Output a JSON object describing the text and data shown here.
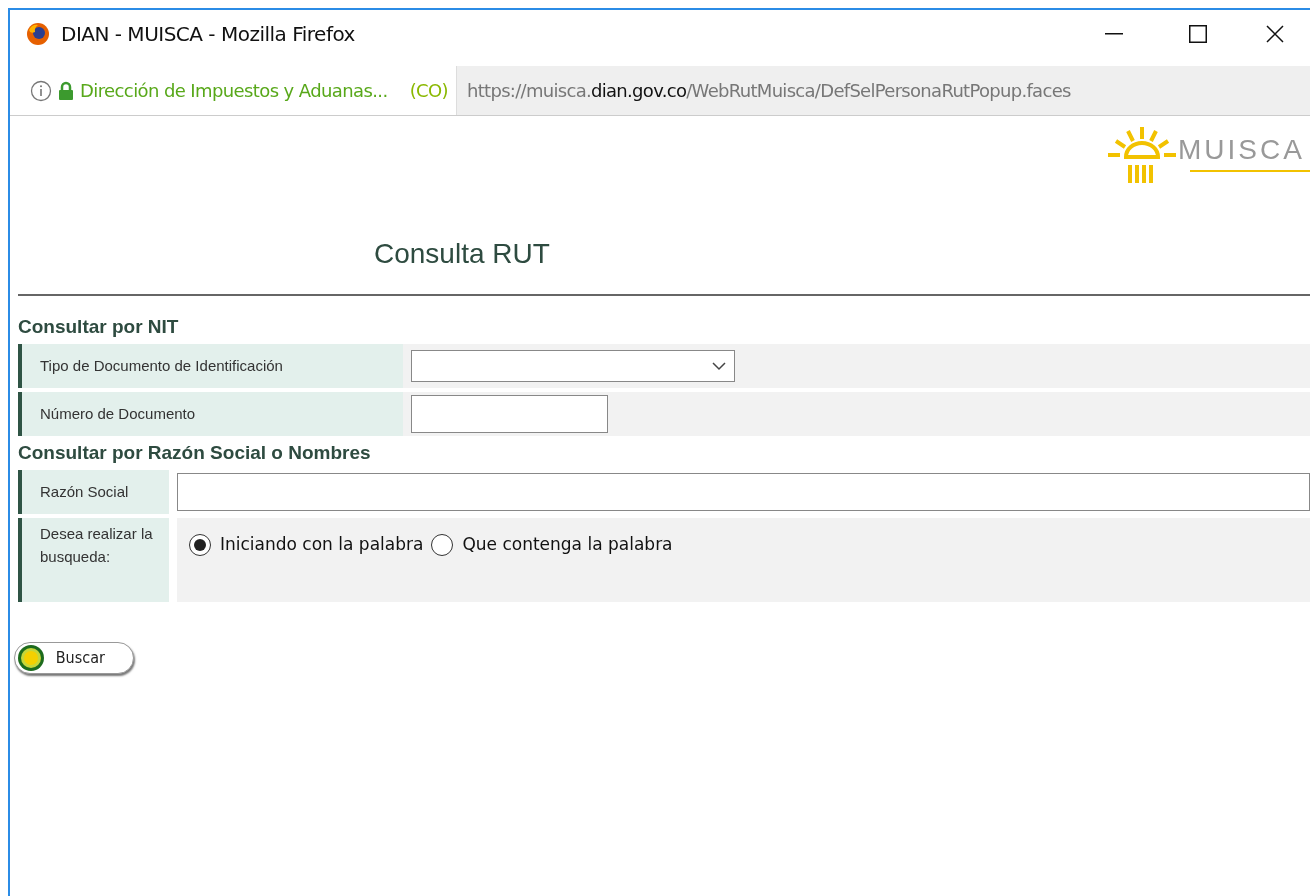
{
  "window": {
    "title": "DIAN - MUISCA - Mozilla Firefox"
  },
  "address_bar": {
    "site_identity": "Dirección de Impuestos y Aduanas...",
    "country": "(CO)",
    "url_prefix": "https://muisca.",
    "url_domain": "dian.gov.co",
    "url_path": "/WebRutMuisca/DefSelPersonaRutPopup.faces"
  },
  "logo": {
    "text": "MUISCA"
  },
  "page_title": "Consulta RUT",
  "sections": [
    {
      "title": "Consultar por NIT",
      "rows": [
        {
          "kind": "select",
          "label": "Tipo de Documento de Identificación"
        },
        {
          "kind": "text",
          "label": "Número de Documento"
        }
      ]
    },
    {
      "title": "Consultar por Razón Social o Nombres",
      "rows": [
        {
          "kind": "text_wide",
          "label": "Razón Social"
        },
        {
          "kind": "radio",
          "label": "Desea realizar la busqueda:",
          "options": [
            {
              "label": "Iniciando con la palabra",
              "selected": true
            },
            {
              "label": "Que contenga la palabra",
              "selected": false
            }
          ]
        }
      ]
    }
  ],
  "search_button": {
    "label": "Buscar"
  }
}
